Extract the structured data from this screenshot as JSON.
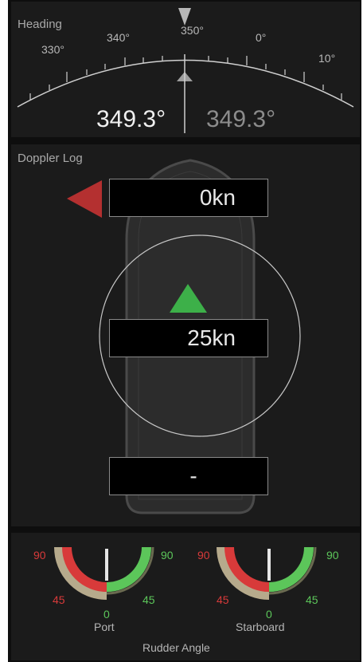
{
  "heading": {
    "label": "Heading",
    "scale_labels": [
      "330°",
      "340°",
      "350°",
      "0°",
      "10°"
    ],
    "value_primary": "349.3°",
    "value_secondary": "349.3°"
  },
  "doppler": {
    "label": "Doppler Log",
    "bow_speed": "0kn",
    "center_speed": "25kn",
    "stern_speed": "-"
  },
  "rudder": {
    "label": "Rudder Angle",
    "port": {
      "label": "Port",
      "top_left": "90",
      "top_right": "90",
      "mid_left": "45",
      "mid_right": "45",
      "bottom": "0"
    },
    "starboard": {
      "label": "Starboard",
      "top_left": "90",
      "top_right": "90",
      "mid_left": "45",
      "mid_right": "45",
      "bottom": "0"
    }
  },
  "colors": {
    "port_red": "#d83a3a",
    "stbd_green": "#5cc65a",
    "accent_grey": "#9e9e9e"
  }
}
